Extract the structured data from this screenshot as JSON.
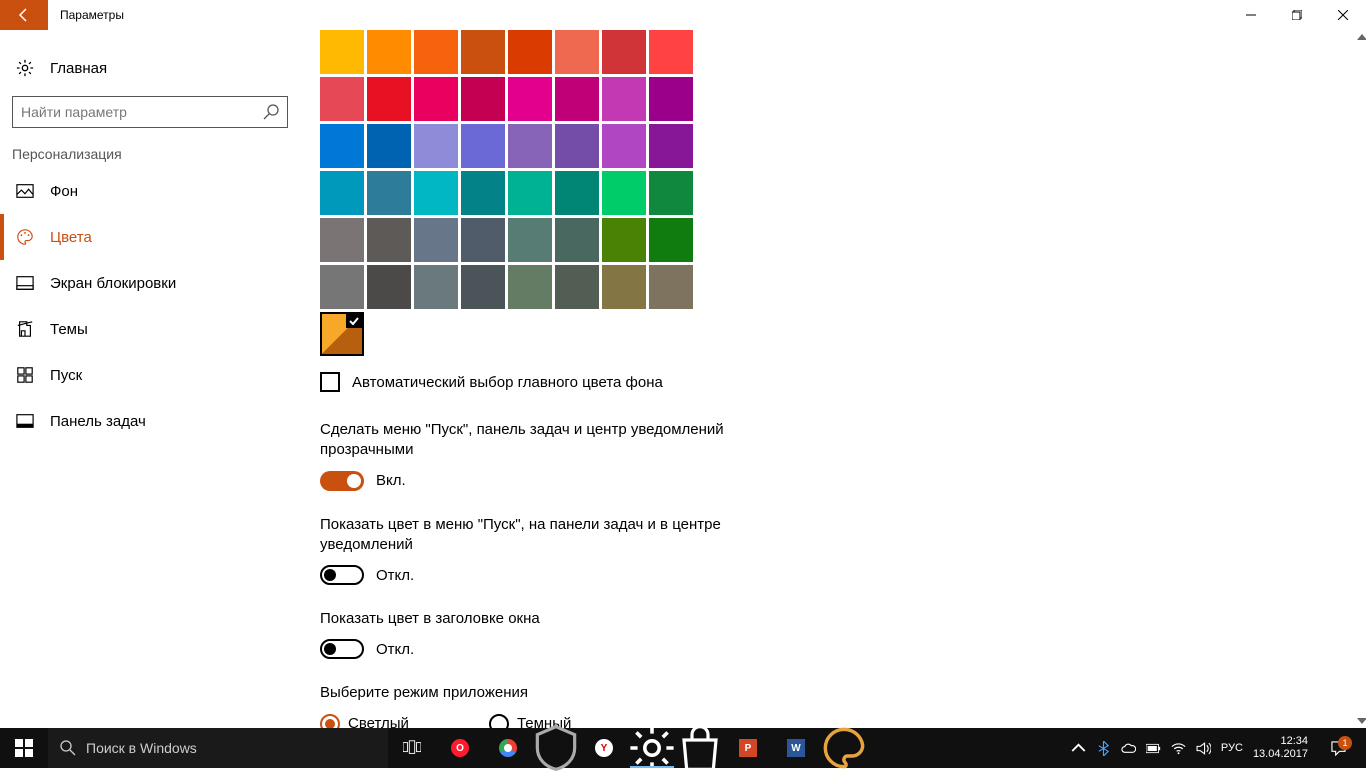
{
  "titlebar": {
    "title": "Параметры"
  },
  "sidebar": {
    "home": "Главная",
    "search_placeholder": "Найти параметр",
    "section": "Персонализация",
    "items": [
      {
        "label": "Фон"
      },
      {
        "label": "Цвета"
      },
      {
        "label": "Экран блокировки"
      },
      {
        "label": "Темы"
      },
      {
        "label": "Пуск"
      },
      {
        "label": "Панель задач"
      }
    ]
  },
  "colors": {
    "palette": [
      "#ffb900",
      "#ff8c00",
      "#f7630c",
      "#ca5010",
      "#da3b01",
      "#ef6950",
      "#d13438",
      "#ff4343",
      "#e74856",
      "#e81123",
      "#ea005e",
      "#c30052",
      "#e3008c",
      "#bf0077",
      "#c239b3",
      "#9a0089",
      "#0078d7",
      "#0063b1",
      "#8e8cd8",
      "#6b69d6",
      "#8764b8",
      "#744da9",
      "#b146c2",
      "#881798",
      "#0099bc",
      "#2d7d9a",
      "#00b7c3",
      "#038387",
      "#00b294",
      "#018574",
      "#00cc6a",
      "#10893e",
      "#7a7574",
      "#5d5a58",
      "#68768a",
      "#515c6b",
      "#567c73",
      "#486860",
      "#498205",
      "#107c10",
      "#767676",
      "#4c4a48",
      "#69797e",
      "#4a5459",
      "#647c64",
      "#525e54",
      "#847545",
      "#7e735f"
    ],
    "auto_pick_label": "Автоматический выбор главного цвета фона",
    "opt_transparency": "Сделать меню \"Пуск\", панель задач и центр уведомлений прозрачными",
    "opt_show_color": "Показать цвет в меню \"Пуск\", на панели задач и в центре уведомлений",
    "opt_titlebar": "Показать цвет в заголовке окна",
    "app_mode_label": "Выберите режим приложения",
    "app_mode_light": "Светлый",
    "app_mode_dark": "Темный",
    "state_on": "Вкл.",
    "state_off": "Откл."
  },
  "taskbar": {
    "search_placeholder": "Поиск в Windows",
    "lang": "РУС",
    "time": "12:34",
    "date": "13.04.2017",
    "notif_count": "1"
  }
}
